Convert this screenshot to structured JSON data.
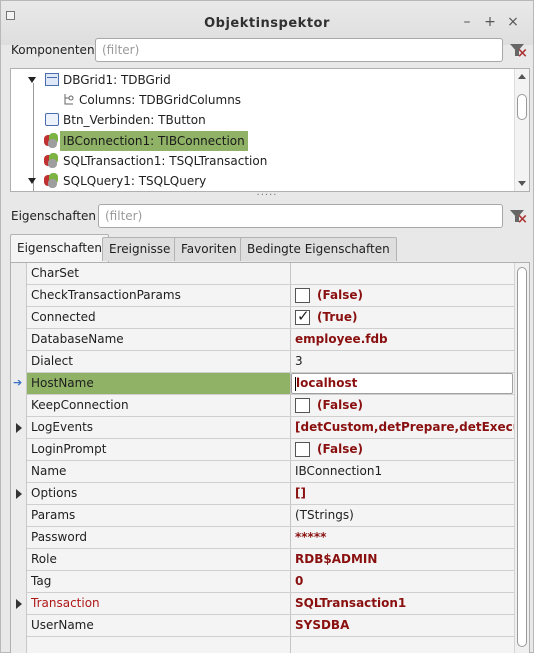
{
  "window": {
    "title": "Objektinspektor",
    "min_glyph": "–",
    "max_glyph": "+",
    "close_glyph": "×"
  },
  "components": {
    "label": "Komponenten",
    "filter_placeholder": "(filter)",
    "tree": [
      {
        "label": "DBGrid1: TDBGrid",
        "icon": "grid-icon"
      },
      {
        "label": "Columns: TDBGridColumns",
        "icon": "collection-icon"
      },
      {
        "label": "Btn_Verbinden: TButton",
        "icon": "button-icon"
      },
      {
        "label": "IBConnection1: TIBConnection",
        "icon": "database-icon",
        "selected": true
      },
      {
        "label": "SQLTransaction1: TSQLTransaction",
        "icon": "database-icon"
      },
      {
        "label": "SQLQuery1: TSQLQuery",
        "icon": "database-icon"
      }
    ]
  },
  "splitter": "·····",
  "properties": {
    "label": "Eigenschaften",
    "filter_placeholder": "(filter)"
  },
  "tabs": [
    "Eigenschaften",
    "Ereignisse",
    "Favoriten",
    "Bedingte Eigenschaften"
  ],
  "grid": {
    "rows": [
      {
        "name": "CharSet",
        "value": ""
      },
      {
        "name": "CheckTransactionParams",
        "value": "(False)",
        "checkbox": false
      },
      {
        "name": "Connected",
        "value": "(True)",
        "checkbox": true
      },
      {
        "name": "DatabaseName",
        "value": "employee.fdb"
      },
      {
        "name": "Dialect",
        "value": "3"
      },
      {
        "name": "HostName",
        "value": "localhost",
        "selected": true
      },
      {
        "name": "KeepConnection",
        "value": "(False)",
        "checkbox": false
      },
      {
        "name": "LogEvents",
        "value": "[detCustom,detPrepare,detExecute,d",
        "expandable": true
      },
      {
        "name": "LoginPrompt",
        "value": "(False)",
        "checkbox": false
      },
      {
        "name": "Name",
        "value": "IBConnection1"
      },
      {
        "name": "Options",
        "value": "[]",
        "expandable": true
      },
      {
        "name": "Params",
        "value": "(TStrings)"
      },
      {
        "name": "Password",
        "value": "*****"
      },
      {
        "name": "Role",
        "value": "RDB$ADMIN"
      },
      {
        "name": "Tag",
        "value": "0"
      },
      {
        "name": "Transaction",
        "value": "SQLTransaction1",
        "expandable": true
      },
      {
        "name": "UserName",
        "value": "SYSDBA"
      }
    ]
  }
}
